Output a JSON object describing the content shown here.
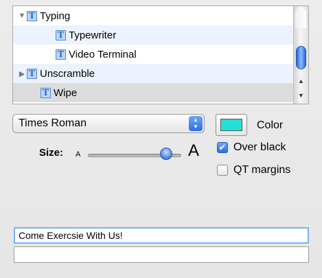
{
  "transitions_list": {
    "items": [
      {
        "label": "Typing",
        "expanded": true,
        "level": 0,
        "icon": "T"
      },
      {
        "label": "Typewriter",
        "level": 1,
        "icon": "T"
      },
      {
        "label": "Video Terminal",
        "level": 1,
        "icon": "T"
      },
      {
        "label": "Unscramble",
        "expanded": false,
        "level": 0,
        "icon": "T"
      },
      {
        "label": "Wipe",
        "level": 0,
        "icon": "T",
        "selected": true
      }
    ]
  },
  "font_popup": {
    "value": "Times Roman"
  },
  "color": {
    "label": "Color",
    "swatch": "#22e0d6"
  },
  "size": {
    "label": "Size:",
    "small": "A",
    "large": "A",
    "value_fraction": 0.84
  },
  "options": {
    "over_black": {
      "label": "Over black",
      "checked": true
    },
    "qt_margins": {
      "label": "QT margins",
      "checked": false
    }
  },
  "text_fields": {
    "line1": "Come Exercsie With Us!",
    "line2": ""
  }
}
